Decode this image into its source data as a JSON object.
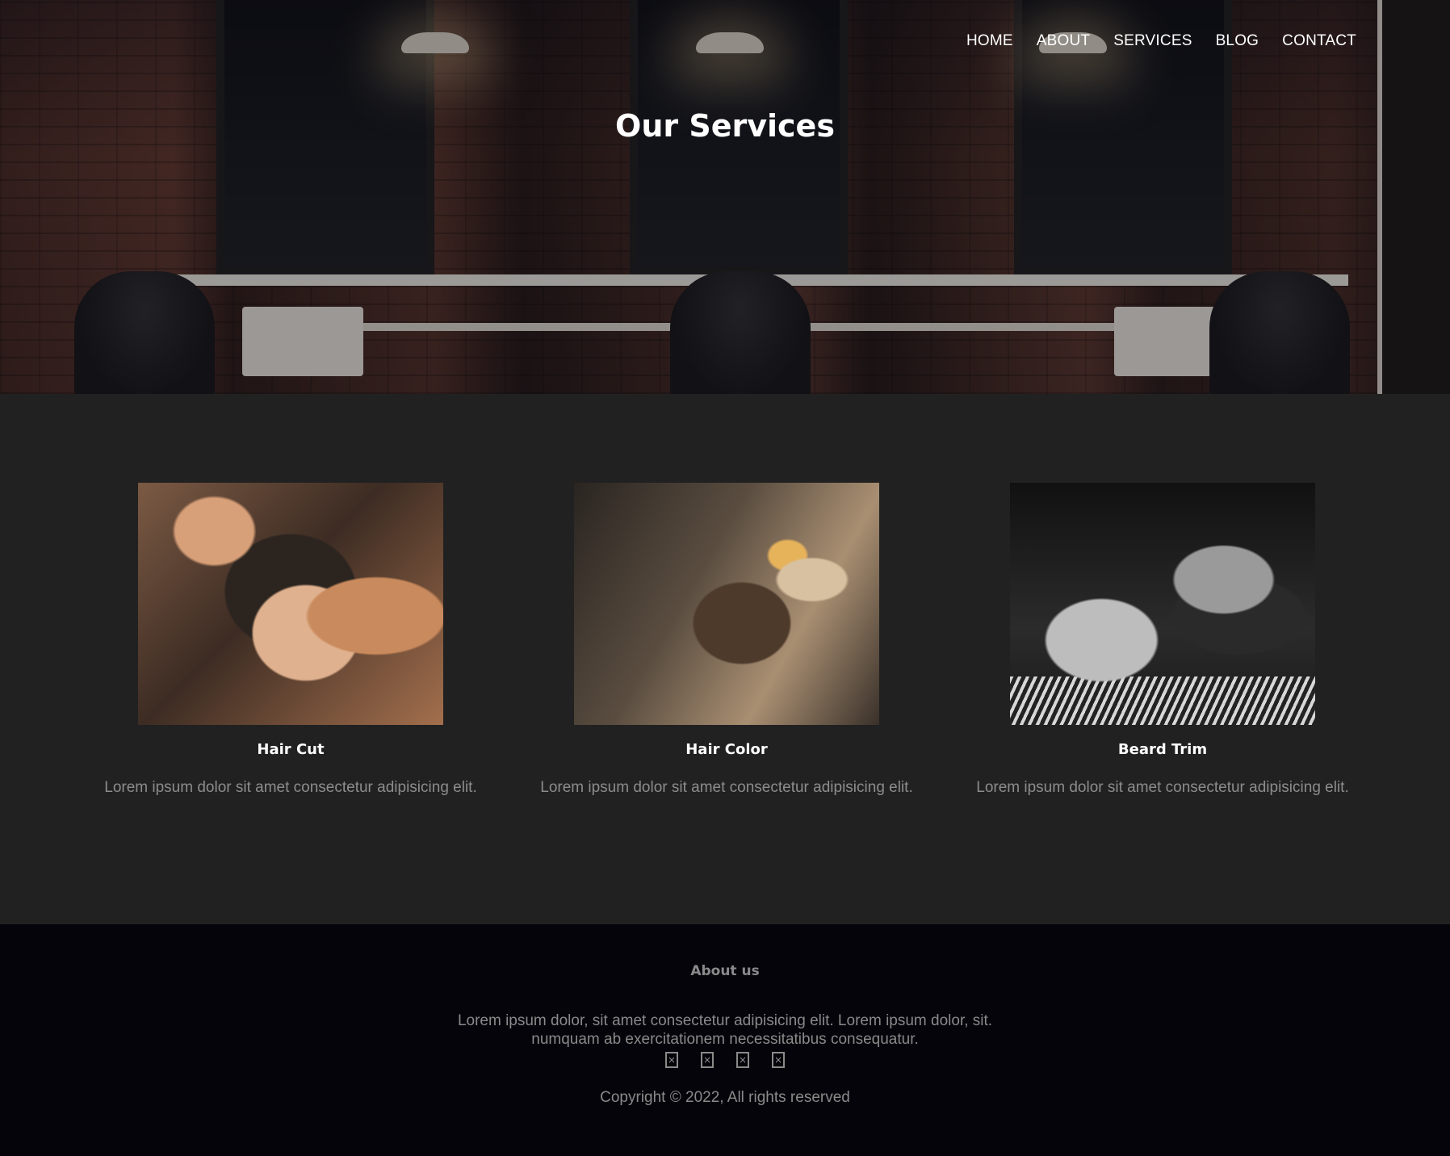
{
  "nav": {
    "items": [
      {
        "label": "HOME"
      },
      {
        "label": "ABOUT"
      },
      {
        "label": "SERVICES"
      },
      {
        "label": "BLOG"
      },
      {
        "label": "CONTACT"
      }
    ]
  },
  "hero": {
    "title": "Our Services"
  },
  "services": [
    {
      "name": "Hair Cut",
      "description": "Lorem ipsum dolor sit amet consectetur adipisicing elit."
    },
    {
      "name": "Hair Color",
      "description": "Lorem ipsum dolor sit amet consectetur adipisicing elit."
    },
    {
      "name": "Beard Trim",
      "description": "Lorem ipsum dolor sit amet consectetur adipisicing elit."
    }
  ],
  "footer": {
    "title": "About us",
    "text_line1": "Lorem ipsum dolor, sit amet consectetur adipisicing elit. Lorem ipsum dolor, sit.",
    "text_line2": "numquam ab exercitationem necessitatibus consequatur.",
    "social_icons": [
      "missing-glyph-icon",
      "missing-glyph-icon",
      "missing-glyph-icon",
      "missing-glyph-icon"
    ],
    "copyright": "Copyright © 2022, All rights reserved"
  },
  "colors": {
    "page_bg": "#212121",
    "footer_bg": "#04040a",
    "muted_text": "#8a8a8a"
  }
}
